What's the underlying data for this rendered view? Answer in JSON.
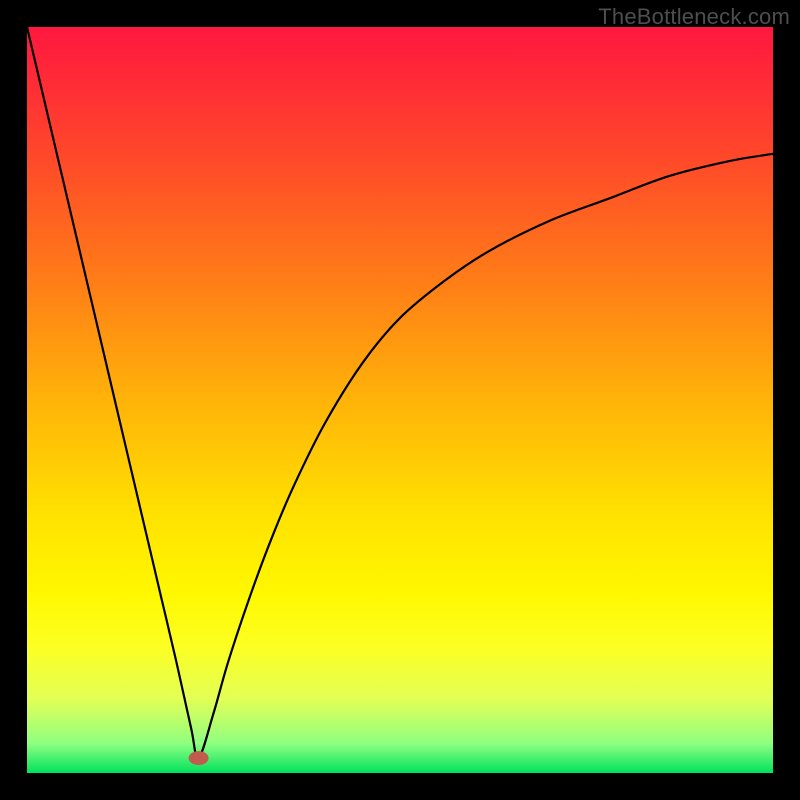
{
  "watermark": "TheBottleneck.com",
  "chart_data": {
    "type": "line",
    "title": "",
    "xlabel": "",
    "ylabel": "",
    "xlim": [
      0,
      100
    ],
    "ylim": [
      0,
      100
    ],
    "gradient_stops": [
      {
        "offset": 0.0,
        "color": "#ff173f"
      },
      {
        "offset": 0.17,
        "color": "#ff472a"
      },
      {
        "offset": 0.34,
        "color": "#ff7d17"
      },
      {
        "offset": 0.5,
        "color": "#ffb309"
      },
      {
        "offset": 0.66,
        "color": "#ffe300"
      },
      {
        "offset": 0.76,
        "color": "#fff800"
      },
      {
        "offset": 0.83,
        "color": "#fcff22"
      },
      {
        "offset": 0.9,
        "color": "#e3ff55"
      },
      {
        "offset": 0.96,
        "color": "#90ff80"
      },
      {
        "offset": 1.0,
        "color": "#00e25e"
      }
    ],
    "minimum_point": {
      "x": 23,
      "y": 2
    },
    "marker": {
      "x": 23,
      "y": 2,
      "rx": 10,
      "ry": 7,
      "color": "#c15b4e"
    },
    "curve_start_y": 100,
    "right_curve_end": {
      "x": 100,
      "y": 83
    },
    "series": [
      {
        "name": "curve",
        "x": [
          0,
          2,
          4,
          6,
          8,
          10,
          12,
          14,
          16,
          18,
          20,
          22,
          23,
          25,
          27,
          30,
          33,
          36,
          40,
          45,
          50,
          56,
          62,
          70,
          78,
          86,
          94,
          100
        ],
        "y": [
          100,
          91.5,
          83,
          74.5,
          66,
          57.5,
          49,
          40.5,
          32,
          23.5,
          15,
          6,
          2,
          8,
          15,
          24,
          32,
          39,
          47,
          55,
          61,
          66,
          70,
          74,
          77,
          80,
          82,
          83
        ]
      }
    ]
  }
}
